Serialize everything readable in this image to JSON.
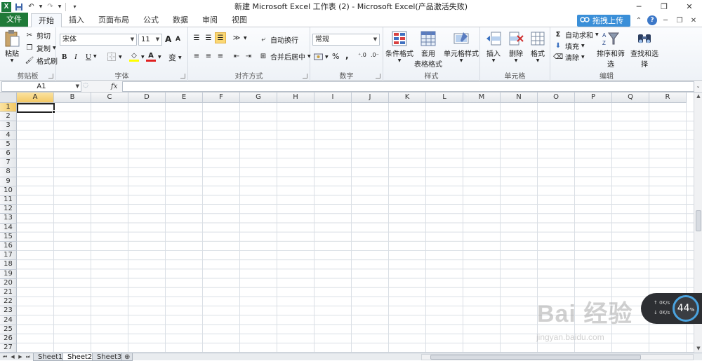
{
  "window": {
    "title": "新建 Microsoft Excel 工作表 (2)  -  Microsoft Excel(产品激活失败)",
    "app_icon": "X",
    "controls": [
      "─",
      "❐",
      "✕"
    ]
  },
  "tabs": {
    "file": "文件",
    "items": [
      "开始",
      "插入",
      "页面布局",
      "公式",
      "数据",
      "审阅",
      "视图"
    ],
    "active": "开始",
    "upload_button": "拖拽上传"
  },
  "ribbon": {
    "clipboard": {
      "label": "剪贴板",
      "paste": "粘贴",
      "cut": "剪切",
      "copy": "复制",
      "format_painter": "格式刷"
    },
    "font": {
      "label": "字体",
      "font_name": "宋体",
      "font_size": "11",
      "bold": "B",
      "italic": "I",
      "underline": "U",
      "grow": "A",
      "shrink": "A",
      "font_color": "A",
      "wen": "变"
    },
    "alignment": {
      "label": "对齐方式",
      "wrap_text": "自动换行",
      "merge_center": "合并后居中"
    },
    "number": {
      "label": "数字",
      "format": "常规",
      "percent": "%",
      "comma": ","
    },
    "styles": {
      "label": "样式",
      "conditional": "条件格式",
      "table_line1": "套用",
      "table_line2": "表格格式",
      "cell_styles": "单元格样式"
    },
    "cells": {
      "label": "单元格",
      "insert": "插入",
      "delete": "删除",
      "format": "格式"
    },
    "editing": {
      "label": "编辑",
      "autosum": "自动求和",
      "fill": "填充",
      "clear": "清除",
      "sort_filter": "排序和筛选",
      "find_select": "查找和选择"
    }
  },
  "formula_bar": {
    "name_box": "A1",
    "fx": "fx",
    "value": ""
  },
  "grid": {
    "columns": [
      "A",
      "B",
      "C",
      "D",
      "E",
      "F",
      "G",
      "H",
      "I",
      "J",
      "K",
      "L",
      "M",
      "N",
      "O",
      "P",
      "Q",
      "R"
    ],
    "rows": [
      "1",
      "2",
      "3",
      "4",
      "5",
      "6",
      "7",
      "8",
      "9",
      "10",
      "11",
      "12",
      "13",
      "14",
      "15",
      "16",
      "17",
      "18",
      "19",
      "20",
      "21",
      "22",
      "23",
      "24",
      "25",
      "26",
      "27"
    ],
    "selected_column": "A",
    "selected_row": "1"
  },
  "sheets": {
    "items": [
      "Sheet1",
      "Sheet2",
      "Sheet3"
    ],
    "active": "Sheet2"
  },
  "overlay": {
    "net_up": "0K/s",
    "net_down": "0K/s",
    "net_percent": "44",
    "percent_sign": "%",
    "watermark_main": "Bai 经验",
    "watermark_sub": "jingyan.baidu.com"
  },
  "colors": {
    "file_tab": "#1f7a38",
    "selection_header": "#f3c864",
    "upload_button": "#3a8fd8",
    "net_ring": "#4aa3df"
  }
}
